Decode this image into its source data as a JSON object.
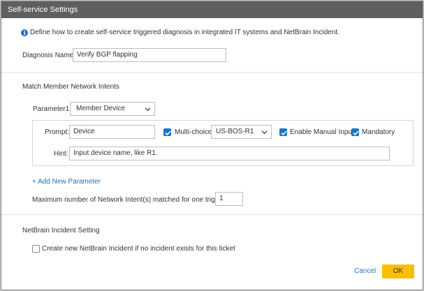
{
  "dialog": {
    "title": "Self-service Settings",
    "close_glyph": "✕",
    "info_text": "Define how to create self-service triggered diagnosis in integrated IT systems and NetBrain Incident.",
    "info_icon_glyph": "i"
  },
  "diagnosis": {
    "label": "Diagnosis Name:",
    "value": "Verify BGP flapping"
  },
  "match_section": {
    "title": "Match Member Network Intents",
    "parameter_label": "Parameter1:",
    "parameter_value": "Member Device",
    "prompt_label": "Prompt:",
    "prompt_value": "Device",
    "multi_choice_label": "Multi-choice:",
    "multi_choice_checked": true,
    "multi_choice_value": "US-BOS-R1",
    "manual_input_label": "Enable Manual Input",
    "manual_input_checked": true,
    "mandatory_label": "Mandatory",
    "mandatory_checked": true,
    "hint_label": "Hint:",
    "hint_value": "Input device name, like R1.",
    "add_parameter_label": "+ Add New Parameter",
    "max_label": "Maximum number of Network Intent(s) matched for one trigger task:",
    "max_value": "1"
  },
  "incident_section": {
    "title": "NetBrain Incident Setting",
    "create_label": "Create new NetBrain Incident if no incident exists for this ticket",
    "create_checked": false
  },
  "footer": {
    "cancel_label": "Cancel",
    "ok_label": "OK"
  },
  "colors": {
    "titlebar": "#5f5f5f",
    "accent_blue": "#1a73c9",
    "ok_yellow": "#f6c000"
  }
}
